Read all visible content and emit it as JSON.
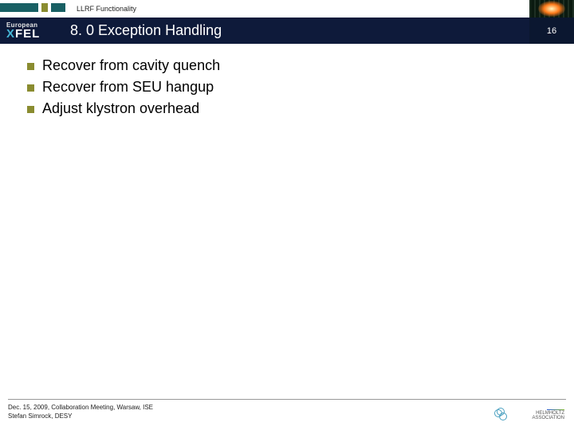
{
  "header": {
    "breadcrumb": "LLRF Functionality",
    "logo_top": "European",
    "logo_main_prefix": "X",
    "logo_main_rest": "FEL",
    "title": "8. 0 Exception Handling",
    "slide_number": "16"
  },
  "bullets": [
    "Recover from cavity quench",
    "Recover from SEU hangup",
    "Adjust klystron overhead"
  ],
  "footer": {
    "line1": "Dec. 15, 2009, Collaboration Meeting, Warsaw, ISE",
    "line2": "Stefan Simrock, DESY"
  }
}
